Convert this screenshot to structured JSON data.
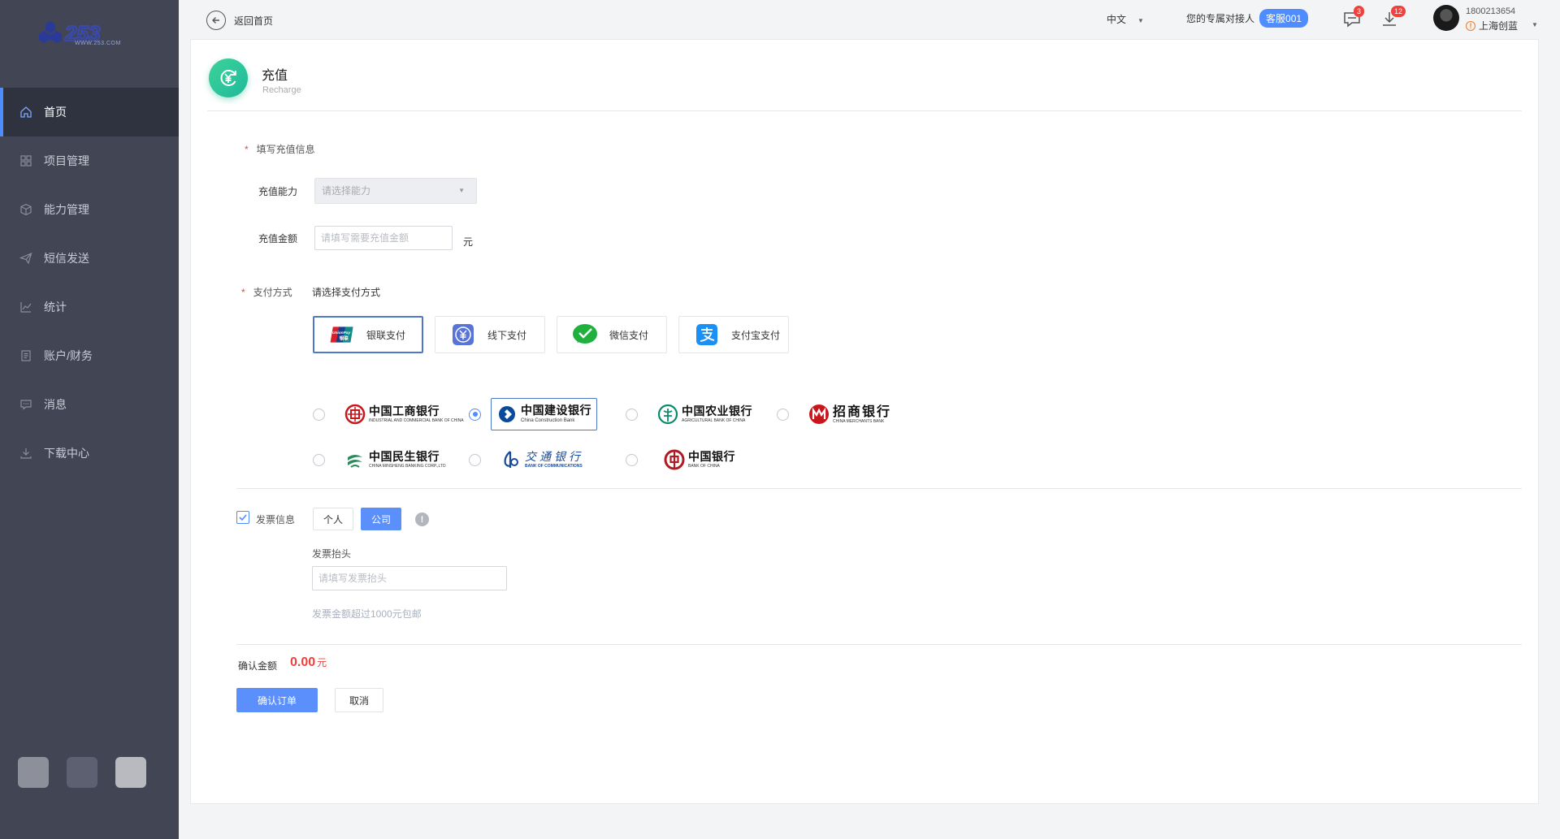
{
  "logo": {
    "text": "WWW.253.COM"
  },
  "sidebar": {
    "items": [
      {
        "label": "首页",
        "icon": "home-icon"
      },
      {
        "label": "项目管理",
        "icon": "grid-icon"
      },
      {
        "label": "能力管理",
        "icon": "cube-icon"
      },
      {
        "label": "短信发送",
        "icon": "send-icon"
      },
      {
        "label": "统计",
        "icon": "chart-icon"
      },
      {
        "label": "账户/财务",
        "icon": "account-icon"
      },
      {
        "label": "消息",
        "icon": "message-icon"
      },
      {
        "label": "下载中心",
        "icon": "download-icon"
      }
    ],
    "active_index": 0,
    "bottom_button_colors": [
      "#8d909b",
      "#5d6070",
      "#b8bac0"
    ]
  },
  "header": {
    "back_label": "返回首页",
    "language": "中文",
    "contact_label": "您的专属对接人",
    "contact_name": "客服001",
    "messages_count": "3",
    "downloads_count": "12",
    "user_phone": "1800213654",
    "user_company": "上海创蓝"
  },
  "page": {
    "title": "充值",
    "subtitle": "Recharge"
  },
  "form": {
    "section_label": "填写充值信息",
    "ability_label": "充值能力",
    "ability_placeholder": "请选择能力",
    "amount_label": "充值金额",
    "amount_placeholder": "请填写需要充值金额",
    "amount_unit": "元",
    "payment_label": "支付方式",
    "payment_hint": "请选择支付方式"
  },
  "payment_methods": [
    {
      "label": "银联支付",
      "icon": "unionpay-icon",
      "selected": true
    },
    {
      "label": "线下支付",
      "icon": "offline-pay-icon",
      "selected": false
    },
    {
      "label": "微信支付",
      "icon": "wechat-pay-icon",
      "selected": false
    },
    {
      "label": "支付宝支付",
      "icon": "alipay-icon",
      "selected": false
    }
  ],
  "banks": [
    {
      "cn": "中国工商银行",
      "en": "INDUSTRIAL AND COMMERCIAL BANK OF CHINA",
      "selected": false,
      "color": "#c8161d"
    },
    {
      "cn": "中国建设银行",
      "en": "China Construction Bank",
      "selected": true,
      "color": "#0a4a9b"
    },
    {
      "cn": "中国农业银行",
      "en": "AGRICULTURAL BANK OF CHINA",
      "selected": false,
      "color": "#0a8a6a"
    },
    {
      "cn": "招商银行",
      "en": "CHINA MERCHANTS BANK",
      "selected": false,
      "color": "#c8161d"
    },
    {
      "cn": "中国民生银行",
      "en": "CHINA MINSHENG BANKING CORP.,LTD",
      "selected": false,
      "color": "#2a8a5a"
    },
    {
      "cn": "交通银行",
      "en": "BANK OF COMMUNICATIONS",
      "selected": false,
      "color": "#1a4a9a"
    },
    {
      "cn": "中国银行",
      "en": "BANK OF CHINA",
      "selected": false,
      "color": "#b01a22"
    }
  ],
  "invoice": {
    "label": "发票信息",
    "checked": true,
    "type_person": "个人",
    "type_company": "公司",
    "selected_type": "公司",
    "title_label": "发票抬头",
    "title_placeholder": "请填写发票抬头",
    "note": "发票金额超过1000元包邮"
  },
  "summary": {
    "confirm_label": "确认金额",
    "amount": "0.00",
    "unit": "元"
  },
  "actions": {
    "confirm": "确认订单",
    "cancel": "取消"
  },
  "colors": {
    "sidebar_bg": "#414554",
    "sidebar_active_bg": "#2f3340",
    "accent": "#4f8cff",
    "primary_button": "#5a8ffc",
    "danger": "#f0413d",
    "title_icon": "#2dc89a"
  }
}
